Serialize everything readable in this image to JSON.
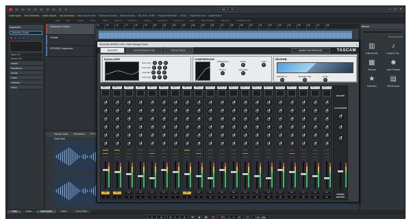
{
  "toolbar": {
    "tempo": "120.000",
    "mode": "Bar",
    "signature": "4/4",
    "window_controls": [
      "–",
      "□",
      "×"
    ]
  },
  "status": {
    "items": [
      "Audio Inputs",
      "Not Connected",
      "Audio Outputs",
      "Not Connected",
      "Max. Record Time",
      "236 hours 32 mins",
      "Record Format",
      "48.1 kHz - 24 Bit",
      "Project Frame Rate",
      "30 fps",
      "Project Pan Law",
      "Equal Power"
    ],
    "highlight_indices": [
      0,
      1,
      2,
      3
    ]
  },
  "info_line": [
    "Start",
    "End",
    "Length",
    "Offset",
    "Snap",
    "Fade-In",
    "Fade-Out",
    "Volume",
    "Transpose",
    "Fine-Tune",
    "Mute",
    "Musical Mode",
    "Algorithm"
  ],
  "info_values": [
    "Standard - Mix"
  ],
  "inspector": {
    "title": "Inspector",
    "track_name": "Distortion Guitar",
    "rows": [
      "Mono In 1",
      "Stereo Out"
    ],
    "sections": [
      "Inserts",
      "Equalizers",
      "Sends",
      "Fader",
      "Notepad",
      "Setup"
    ]
  },
  "tracks": [
    {
      "name": "Distortion Guitar",
      "color": "#c0392b",
      "selected": true
    },
    {
      "name": "Vocals",
      "color": "#3b7cc4",
      "selected": false
    },
    {
      "name": "STEREO Imported",
      "color": "#3b7cc4",
      "selected": false
    }
  ],
  "ruler": [
    "74",
    "75",
    "76",
    "77",
    "78",
    "79",
    "80",
    "81",
    "82",
    "83",
    "84",
    "85",
    "86",
    "87",
    "88",
    "89",
    "90",
    "91",
    "92",
    "93",
    "94",
    "95",
    "96",
    "97",
    "98"
  ],
  "editor": {
    "tabs": [
      "Sample Data",
      "Resolution"
    ],
    "channel_label": "FX Channels",
    "clip_name": "Event Start"
  },
  "right_zone": {
    "title": "Media",
    "show_all": "Show All Items",
    "items": [
      {
        "label": "Instruments",
        "icon": "piano-icon",
        "glyph": "▥"
      },
      {
        "label": "Loops & Sa...",
        "icon": "loops-icon",
        "glyph": "♪"
      },
      {
        "label": "Presets",
        "icon": "presets-icon",
        "glyph": "▦"
      },
      {
        "label": "User Presets",
        "icon": "user-presets-icon",
        "glyph": "☻"
      },
      {
        "label": "Favorites",
        "icon": "star-icon",
        "glyph": "★"
      },
      {
        "label": "File Browser",
        "icon": "file-browser-icon",
        "glyph": "▤"
      }
    ]
  },
  "bottom_tabs": [
    {
      "label": "Track",
      "active": true
    },
    {
      "label": "Editor",
      "active": false
    },
    {
      "label": "MixConsole",
      "active": true
    },
    {
      "label": "Editor",
      "active": false
    },
    {
      "label": "Chord Pads",
      "active": false
    }
  ],
  "transport": {
    "left_locator": "1. 1. 1. 0",
    "right_locator": "9. 1. 1. 0",
    "position": "797. 1. 1. 19",
    "tempo": "120.000"
  },
  "plugin": {
    "title": "TASCAM SERIES 102i / 208i Settings Panel",
    "tabs": [
      "MIXER",
      "INFORMATION",
      "ROUTING"
    ],
    "active_tab": "MIXER",
    "audio_interface_label": "AUDIO INTERFACE",
    "brand": "TASCAM",
    "fx": {
      "equalizer": "EQUALIZER",
      "compressor": "COMPRESSOR",
      "reverb": "REVERB",
      "comp_params": [
        "THRESHOLD",
        "RATIO",
        "GAIN",
        "ATTACK",
        "RELEASE"
      ],
      "eq_params": [
        "HIGH FRQ",
        "HIGH MID",
        "LOW MID",
        "LOW FRQ"
      ],
      "reverb_params": [
        "PRE DELAY",
        "REVERB TIME",
        "LEVEL"
      ],
      "reverb_type": "HALL"
    },
    "channels": [
      {
        "name": "INPUT 1",
        "num": "1",
        "val": "0.0",
        "hl": true
      },
      {
        "name": "INPUT 2",
        "num": "2",
        "val": "0.0",
        "hl": true
      },
      {
        "name": "INPUT 3",
        "num": "3",
        "val": "0.0",
        "hl": false
      },
      {
        "name": "INPUT 4",
        "num": "4",
        "val": "0.0",
        "hl": false
      },
      {
        "name": "INPUT 5",
        "num": "5",
        "val": "0.0",
        "hl": false
      },
      {
        "name": "INPUT 6",
        "num": "6",
        "val": "0.0",
        "hl": false
      },
      {
        "name": "INPUT 7",
        "num": "7",
        "val": "0.0",
        "hl": false
      },
      {
        "name": "INPUT 8",
        "num": "8",
        "val": "0.0",
        "hl": true
      },
      {
        "name": "INPUT 9",
        "num": "9",
        "val": "0.0",
        "hl": false
      },
      {
        "name": "INPUT 10",
        "num": "10",
        "val": "0.0",
        "hl": false
      },
      {
        "name": "INPUT 11",
        "num": "11",
        "val": "0.0",
        "hl": false
      },
      {
        "name": "INPUT 12",
        "num": "12",
        "val": "0.0",
        "hl": false
      },
      {
        "name": "INPUT 13",
        "num": "13",
        "val": "0.0",
        "hl": false
      },
      {
        "name": "INPUT 14",
        "num": "14",
        "val": "0.0",
        "hl": false
      },
      {
        "name": "INPUT 15",
        "num": "15",
        "val": "0.0",
        "hl": false
      },
      {
        "name": "INPUT 16",
        "num": "16",
        "val": "0.0",
        "hl": false
      },
      {
        "name": "INPUT 17",
        "num": "17",
        "val": "0.0",
        "hl": false
      },
      {
        "name": "INPUT 18",
        "num": "18",
        "val": "0.0",
        "hl": false
      },
      {
        "name": "INPUT 19",
        "num": "19",
        "val": "0.0",
        "hl": false
      },
      {
        "name": "INPUT 20",
        "num": "20",
        "val": "0.0",
        "hl": false
      }
    ],
    "aux": {
      "return_label": "RETURN",
      "aux_master": "AUX MASTER",
      "stereo_master": "STEREO MASTER"
    }
  }
}
